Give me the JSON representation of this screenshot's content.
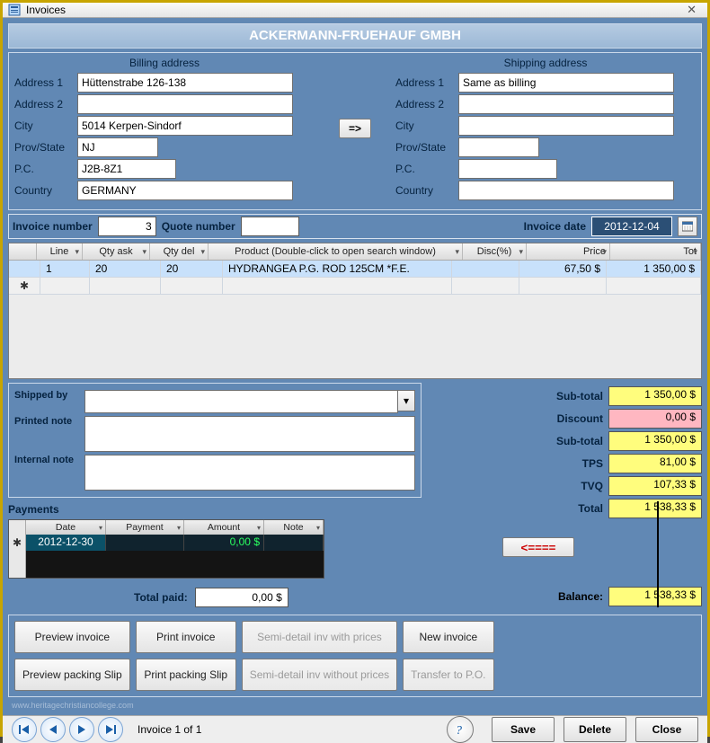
{
  "window": {
    "title": "Invoices"
  },
  "company_name": "ACKERMANN-FRUEHAUF GMBH",
  "billing": {
    "heading": "Billing address",
    "labels": {
      "addr1": "Address 1",
      "addr2": "Address 2",
      "city": "City",
      "prov": "Prov/State",
      "pc": "P.C.",
      "country": "Country"
    },
    "addr1": "Hüttenstrabe 126-138",
    "addr2": "",
    "city": "5014 Kerpen-Sindorf",
    "prov": "NJ",
    "pc": "J2B-8Z1",
    "country": "GERMANY"
  },
  "shipping": {
    "heading": "Shipping address",
    "addr1": "Same as billing",
    "addr2": "",
    "city": "",
    "prov": "",
    "pc": "",
    "country": ""
  },
  "copy_btn": "=>",
  "meta": {
    "invoice_number_label": "Invoice number",
    "invoice_number": "3",
    "quote_number_label": "Quote number",
    "quote_number": "",
    "invoice_date_label": "Invoice date",
    "invoice_date": "2012-12-04"
  },
  "grid": {
    "headers": {
      "line": "Line",
      "qty_ask": "Qty ask",
      "qty_del": "Qty del",
      "product": "Product (Double-click to open search window)",
      "disc": "Disc(%)",
      "price": "Price",
      "tot": "Tot"
    },
    "rows": [
      {
        "line": "1",
        "qty_ask": "20",
        "qty_del": "20",
        "product": "HYDRANGEA P.G. ROD 125CM  *F.E.",
        "disc": "",
        "price": "67,50 $",
        "tot": "1 350,00 $"
      }
    ]
  },
  "notes": {
    "shipped_by_label": "Shipped by",
    "shipped_by": "",
    "printed_label": "Printed note",
    "printed": "",
    "internal_label": "Internal note",
    "internal": ""
  },
  "payments": {
    "heading": "Payments",
    "headers": {
      "date": "Date",
      "payment": "Payment",
      "amount": "Amount",
      "note": "Note"
    },
    "rows": [
      {
        "date": "2012-12-30",
        "payment": "",
        "amount": "0,00 $",
        "note": ""
      }
    ],
    "total_paid_label": "Total paid:",
    "total_paid": "0,00 $"
  },
  "totals": {
    "subtotal_label": "Sub-total",
    "subtotal": "1 350,00 $",
    "discount_label": "Discount",
    "discount": "0,00 $",
    "subtotal2_label": "Sub-total",
    "subtotal2": "1 350,00 $",
    "tps_label": "TPS",
    "tps": "81,00 $",
    "tvq_label": "TVQ",
    "tvq": "107,33 $",
    "total_label": "Total",
    "total": "1 538,33 $",
    "arrow_label": "<====",
    "balance_label": "Balance:",
    "balance": "1 538,33 $"
  },
  "actions": {
    "preview_invoice": "Preview invoice",
    "print_invoice": "Print invoice",
    "semi_with": "Semi-detail inv with prices",
    "new_invoice": "New invoice",
    "preview_packing": "Preview packing Slip",
    "print_packing": "Print packing Slip",
    "semi_without": "Semi-detail inv without prices",
    "transfer_po": "Transfer to P.O."
  },
  "footer": {
    "pager": "Invoice 1 of 1",
    "save": "Save",
    "delete": "Delete",
    "close": "Close"
  },
  "watermark": "www.heritagechristiancollege.com"
}
